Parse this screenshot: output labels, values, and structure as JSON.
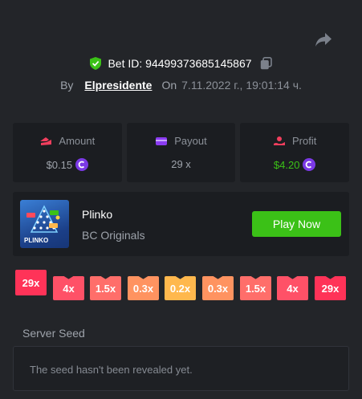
{
  "bet": {
    "label": "Bet ID:",
    "id": "94499373685145867"
  },
  "meta": {
    "by_label": "By",
    "user": "Elpresidente",
    "on_label": "On",
    "date": "7.11.2022 г., 19:01:14 ч."
  },
  "stats": {
    "amount": {
      "label": "Amount",
      "value": "$0.15"
    },
    "payout": {
      "label": "Payout",
      "value": "29 x"
    },
    "profit": {
      "label": "Profit",
      "value": "$4.20"
    }
  },
  "game": {
    "name": "Plinko",
    "provider": "BC Originals",
    "thumb_text": "PLINKO",
    "play_label": "Play Now"
  },
  "multipliers": [
    {
      "label": "29x",
      "color": "#ff3358",
      "hit": true
    },
    {
      "label": "4x",
      "color": "#ff5167",
      "hit": false
    },
    {
      "label": "1.5x",
      "color": "#ff6e6a",
      "hit": false
    },
    {
      "label": "0.3x",
      "color": "#ff9360",
      "hit": false
    },
    {
      "label": "0.2x",
      "color": "#ffb84d",
      "hit": false
    },
    {
      "label": "0.3x",
      "color": "#ff9360",
      "hit": false
    },
    {
      "label": "1.5x",
      "color": "#ff6e6a",
      "hit": false
    },
    {
      "label": "4x",
      "color": "#ff5167",
      "hit": false
    },
    {
      "label": "29x",
      "color": "#ff3358",
      "hit": false
    }
  ],
  "seed": {
    "title": "Server Seed",
    "message": "The seed hasn't been revealed yet."
  },
  "colors": {
    "accent_green": "#3bc117",
    "coin_purple": "#7b39e6",
    "background": "#232529",
    "card": "#1b1d21"
  }
}
